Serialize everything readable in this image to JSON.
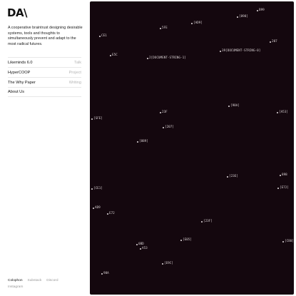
{
  "brand": {
    "logo": "DA\\"
  },
  "tagline": "A cooperative braintrust designing desirable systems, tools and thoughts to simultaneously prevent and adapt to the most radical futures.",
  "menu": [
    {
      "label": "Likeminds 6.0",
      "tag": "Talk"
    },
    {
      "label": "HyperCOOP",
      "tag": "Project"
    },
    {
      "label": "The Why Paper",
      "tag": "Writing"
    },
    {
      "label": "About Us",
      "tag": ""
    }
  ],
  "footer": {
    "links": [
      "Colophon",
      "Substack",
      "Discord",
      "Instagram"
    ]
  },
  "canvas": {
    "nodes": [
      "B99",
      "[898]",
      "[AD9]",
      "5FE",
      "207",
      "CE1",
      "[SFE]",
      "39[DOCUMENT-STRING-0]",
      "E5C",
      "2[DOCUMENT-STRING-1]",
      "[98A]",
      "[A53]",
      "23F",
      "[207]",
      "[889]",
      "[23E]",
      "898",
      "[CE1]",
      "[E72]",
      "AD9",
      "E72",
      "[23F]",
      "[E05]",
      "[C80]",
      "0BD",
      "A53",
      "[E9C]",
      "98A"
    ]
  }
}
